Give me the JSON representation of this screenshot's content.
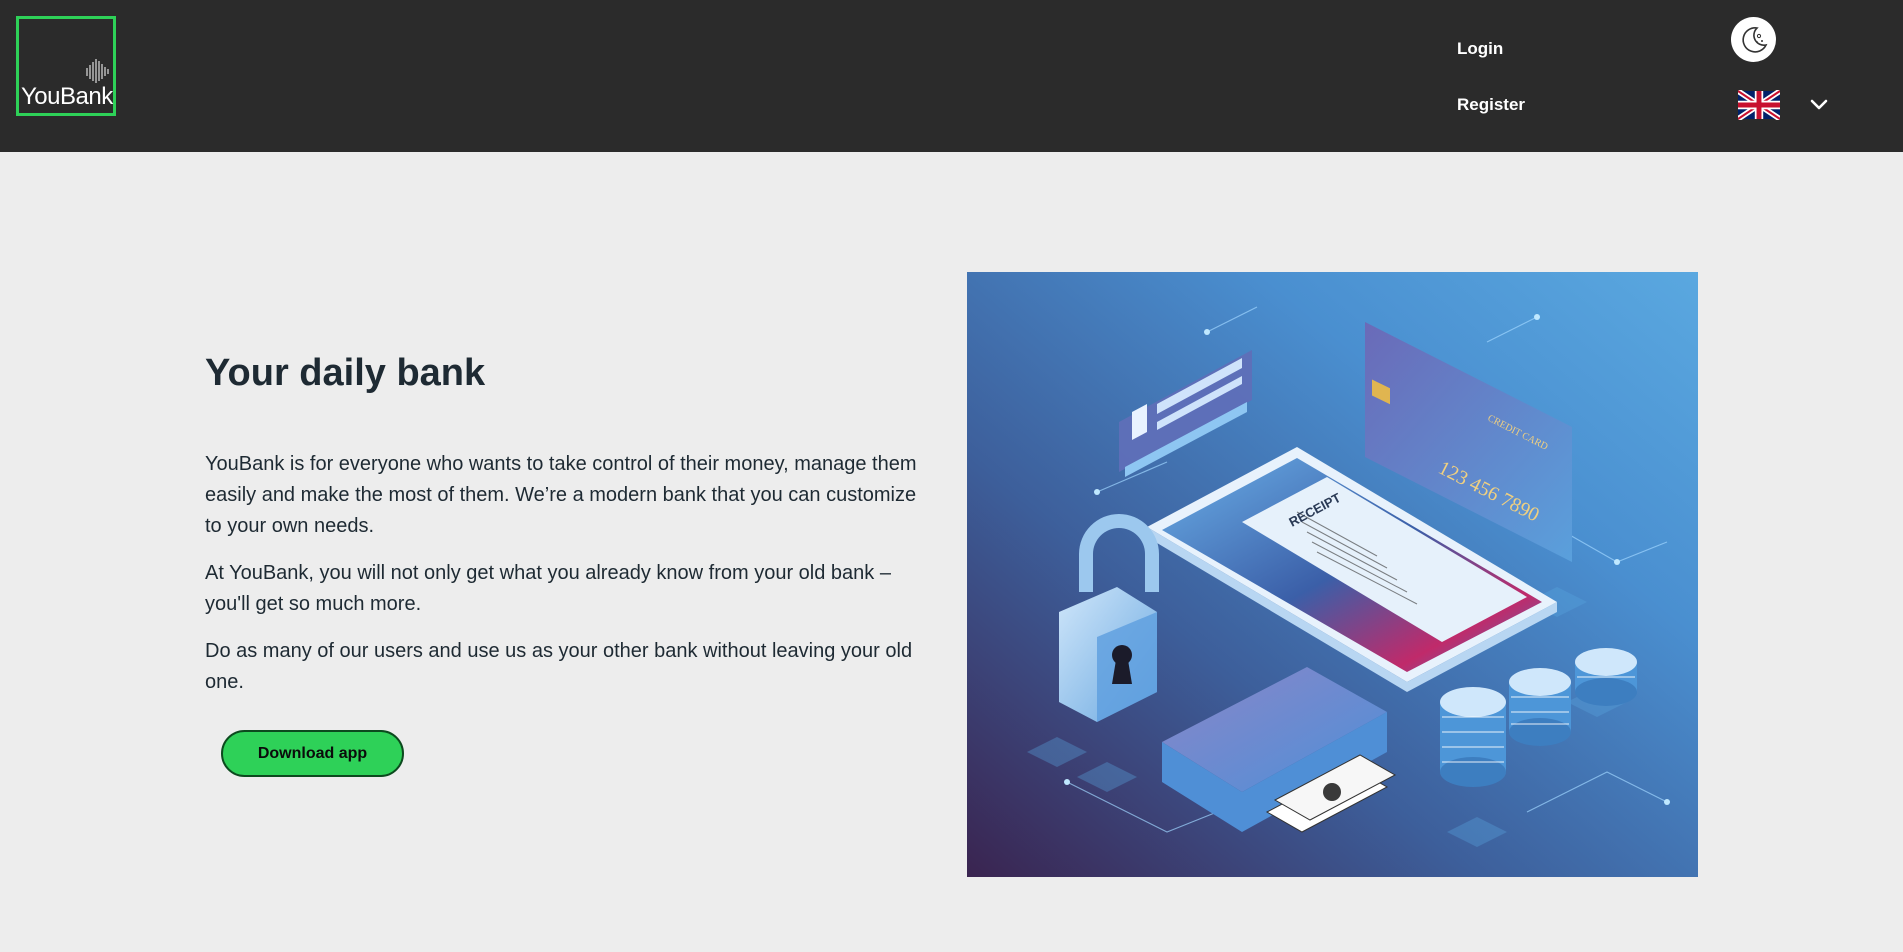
{
  "header": {
    "logo_text": "YouBank",
    "nav": {
      "login": "Login",
      "register": "Register"
    },
    "language": {
      "selected": "English",
      "flag_icon": "uk-flag-icon"
    },
    "theme_toggle_icon": "moon-icon"
  },
  "hero": {
    "title": "Your daily bank",
    "paragraphs": [
      "YouBank is for everyone who wants to take control of their money, manage them easily and make the most of them. We’re a modern bank that you can customize to your own needs.",
      "At YouBank, you will not only get what you already know from your old bank – you'll get so much more.",
      "Do as many of our users and use us as your other bank without leaving your old one."
    ],
    "download_label": "Download app"
  },
  "illustration": {
    "receipt_label": "RECEIPT",
    "card_label": "CREDIT CARD",
    "card_number": "123 456 7890"
  },
  "colors": {
    "header_bg": "#2b2b2b",
    "page_bg": "#ededed",
    "accent_green": "#2ed158",
    "text_dark": "#1e2a33"
  }
}
